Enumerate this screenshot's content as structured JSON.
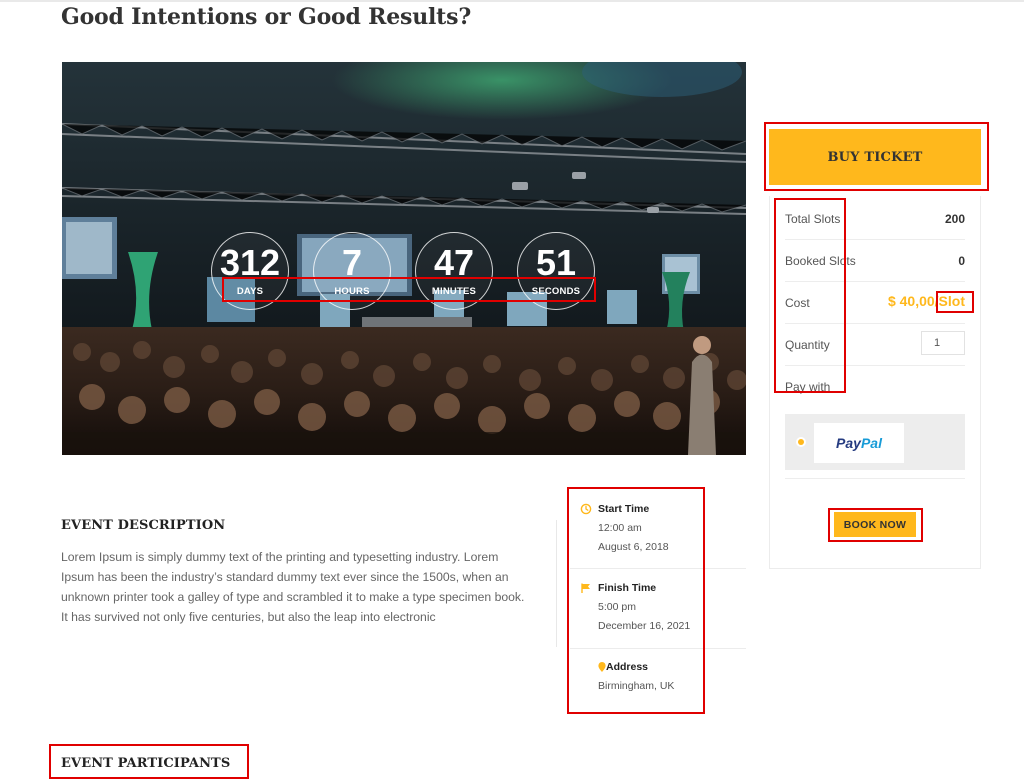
{
  "page": {
    "title": "Good Intentions or Good Results?"
  },
  "countdown": [
    {
      "value": "312",
      "label": "DAYS"
    },
    {
      "value": "7",
      "label": "HOURS"
    },
    {
      "value": "47",
      "label": "MINUTES"
    },
    {
      "value": "51",
      "label": "SECONDS"
    }
  ],
  "booking": {
    "buy_label": "BUY TICKET",
    "total_slots_label": "Total Slots",
    "total_slots_value": "200",
    "booked_slots_label": "Booked Slots",
    "booked_slots_value": "0",
    "cost_label": "Cost",
    "cost_value": "$ 40,00/Slot",
    "quantity_label": "Quantity",
    "quantity_value": "1",
    "pay_with_label": "Pay with",
    "paypal_part1": "Pay",
    "paypal_part2": "Pal",
    "book_now_label": "BOOK NOW",
    "accent_color": "#ffb81c"
  },
  "description": {
    "heading": "EVENT DESCRIPTION",
    "text": "Lorem Ipsum is simply dummy text of the printing and typesetting industry. Lorem Ipsum has been the industry’s standard dummy text ever since the 1500s, when an unknown printer took a galley of type and scrambled it to make a type specimen book. It has survived not only five centuries, but also the leap into electronic"
  },
  "meta": {
    "start_label": "Start Time",
    "start_time": "12:00 am",
    "start_date": "August 6, 2018",
    "finish_label": "Finish Time",
    "finish_time": "5:00 pm",
    "finish_date": "December 16, 2021",
    "address_label": "Address",
    "address_value": "Birmingham, UK"
  },
  "participants": {
    "heading": "EVENT PARTICIPANTS"
  }
}
